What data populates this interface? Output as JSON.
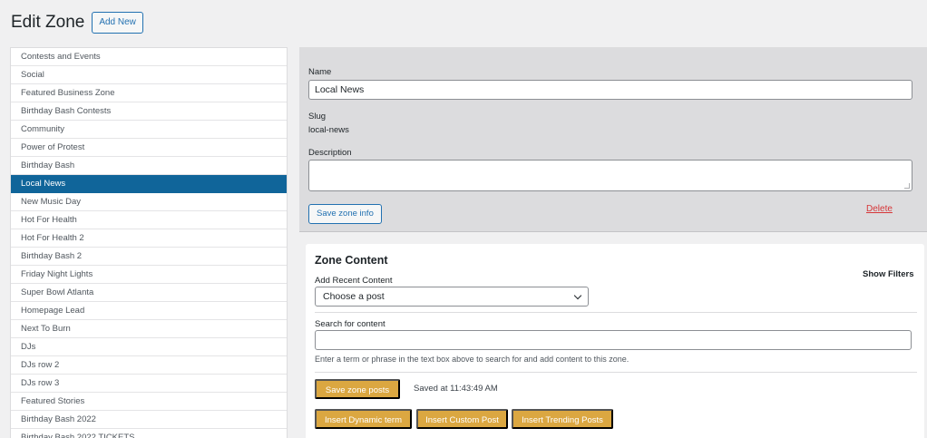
{
  "header": {
    "title": "Edit Zone",
    "add_new_label": "Add New"
  },
  "sidebar": {
    "active_index": 7,
    "items": [
      "Contests and Events",
      "Social",
      "Featured Business Zone",
      "Birthday Bash Contests",
      "Community",
      "Power of Protest",
      "Birthday Bash",
      "Local News",
      "New Music Day",
      "Hot For Health",
      "Hot For Health 2",
      "Birthday Bash 2",
      "Friday Night Lights",
      "Super Bowl Atlanta",
      "Homepage Lead",
      "Next To Burn",
      "DJs",
      "DJs row 2",
      "DJs row 3",
      "Featured Stories",
      "Birthday Bash 2022",
      "Birthday Bash 2022 TICKETS"
    ]
  },
  "zone_info": {
    "name_label": "Name",
    "name_value": "Local News",
    "slug_label": "Slug",
    "slug_value": "local-news",
    "description_label": "Description",
    "description_value": "",
    "save_label": "Save zone info",
    "delete_label": "Delete"
  },
  "zone_content": {
    "title": "Zone Content",
    "show_filters_label": "Show Filters",
    "recent_label": "Add Recent Content",
    "recent_selected": "Choose a post",
    "search_label": "Search for content",
    "search_value": "",
    "help_text": "Enter a term or phrase in the text box above to search for and add content to this zone.",
    "save_posts_label": "Save zone posts",
    "saved_status": "Saved at 11:43:49 AM",
    "insert_buttons": [
      "Insert Dynamic term",
      "Insert Custom Post",
      "Insert Trending Posts"
    ]
  },
  "colors": {
    "accent": "#2271b1",
    "active_item": "#10659a",
    "gold_button": "#dba741",
    "delete": "#d63638"
  }
}
